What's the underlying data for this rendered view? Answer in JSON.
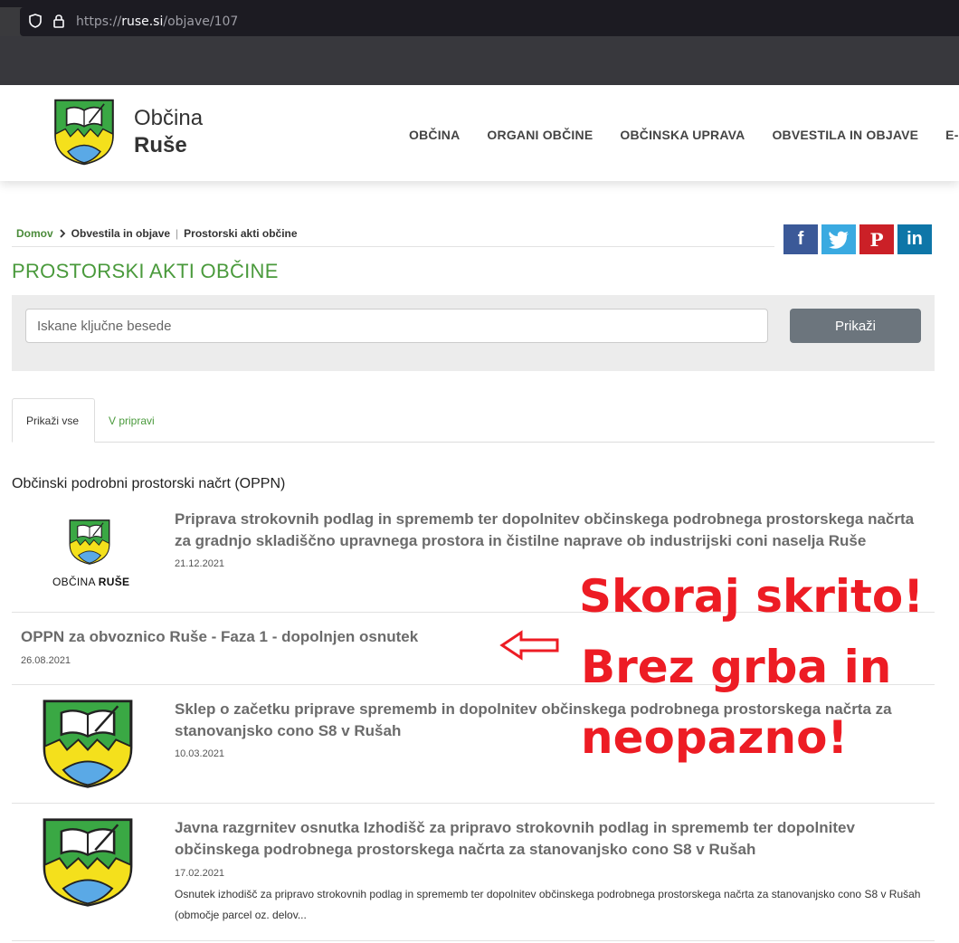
{
  "browser": {
    "url_prefix": "https://",
    "url_host": "ruse.si",
    "url_path": "/objave/107"
  },
  "header": {
    "brand_line1": "Občina",
    "brand_line2": "Ruše",
    "nav": [
      "OBČINA",
      "ORGANI OBČINE",
      "OBČINSKA UPRAVA",
      "OBVESTILA IN OBJAVE",
      "E-OBČ"
    ]
  },
  "breadcrumb": {
    "home": "Domov",
    "level1": "Obvestila in objave",
    "separator": "|",
    "level2": "Prostorski akti občine"
  },
  "social": {
    "facebook": "f",
    "twitter": "twitter-icon",
    "pinterest": "P",
    "linkedin": "in"
  },
  "page_title": "PROSTORSKI AKTI OBČINE",
  "search": {
    "placeholder": "Iskane ključne besede",
    "button_label": "Prikaži"
  },
  "tabs": {
    "all": "Prikaži vse",
    "pending": "V pripravi"
  },
  "section_title": "Občinski podrobni prostorski načrt (OPPN)",
  "items": [
    {
      "title": "Priprava strokovnih podlag in sprememb ter dopolnitev občinskega podrobnega prostorskega načrta za gradnjo skladiščno upravnega prostora in čistilne naprave ob industrijski coni naselja Ruše",
      "date": "21.12.2021",
      "logo_caption_1": "OBČINA",
      "logo_caption_2": "RUŠE"
    },
    {
      "title": "OPPN za obvoznico Ruše - Faza 1 - dopolnjen osnutek",
      "date": "26.08.2021"
    },
    {
      "title": "Sklep o začetku priprave sprememb in dopolnitev občinskega podrobnega prostorskega načrta za stanovanjsko cono S8 v Rušah",
      "date": "10.03.2021"
    },
    {
      "title": "Javna razgrnitev osnutka Izhodišč za pripravo strokovnih podlag in sprememb ter dopolnitev občinskega podrobnega prostorskega načrta za stanovanjsko cono S8 v Rušah",
      "date": "17.02.2021",
      "desc": "Osnutek izhodišč za pripravo strokovnih podlag in sprememb ter dopolnitev občinskega podrobnega prostorskega načrta za stanovanjsko cono S8 v Rušah (območje parcel oz. delov..."
    }
  ],
  "annotation": {
    "line1": "Skoraj skrito!",
    "line2": "Brez grba in",
    "line3": "neopazno!",
    "color": "#ed1c24"
  },
  "colors": {
    "accent_green": "#4a9a3c",
    "button_gray": "#6c757d",
    "panel_gray": "#ececec"
  }
}
